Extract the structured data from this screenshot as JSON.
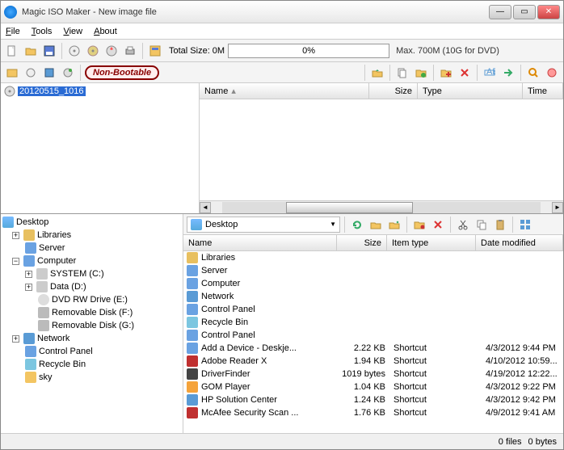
{
  "window": {
    "title": "Magic ISO Maker - New image file"
  },
  "menu": {
    "file": "File",
    "tools": "Tools",
    "view": "View",
    "about": "About"
  },
  "toolbar1": {
    "totalSize": "Total Size: 0M",
    "progress": "0%",
    "max": "Max. 700M (10G for DVD)"
  },
  "bootable": {
    "label": "Non-Bootable"
  },
  "imgtree": {
    "selected": "20120515_1016"
  },
  "imglist": {
    "cols": {
      "name": "Name",
      "size": "Size",
      "type": "Type",
      "time": "Time"
    }
  },
  "tree": {
    "desktop": "Desktop",
    "libraries": "Libraries",
    "server": "Server",
    "computer": "Computer",
    "systemC": "SYSTEM (C:)",
    "dataD": "Data (D:)",
    "dvdE": "DVD RW Drive (E:)",
    "remF": "Removable Disk (F:)",
    "remG": "Removable Disk (G:)",
    "network": "Network",
    "cpanel": "Control Panel",
    "recycle": "Recycle Bin",
    "sky": "sky"
  },
  "path": {
    "current": "Desktop"
  },
  "filelist": {
    "cols": {
      "name": "Name",
      "size": "Size",
      "type": "Item type",
      "date": "Date modified"
    },
    "rows": [
      {
        "name": "Libraries",
        "size": "",
        "type": "",
        "date": "",
        "iconColor": "#e8c060"
      },
      {
        "name": "Server",
        "size": "",
        "type": "",
        "date": "",
        "iconColor": "#6aa2e2"
      },
      {
        "name": "Computer",
        "size": "",
        "type": "",
        "date": "",
        "iconColor": "#6aa2e2"
      },
      {
        "name": "Network",
        "size": "",
        "type": "",
        "date": "",
        "iconColor": "#5a9bd5"
      },
      {
        "name": "Control Panel",
        "size": "",
        "type": "",
        "date": "",
        "iconColor": "#6aa2e2"
      },
      {
        "name": "Recycle Bin",
        "size": "",
        "type": "",
        "date": "",
        "iconColor": "#7cc6e0"
      },
      {
        "name": "Control Panel",
        "size": "",
        "type": "",
        "date": "",
        "iconColor": "#6aa2e2"
      },
      {
        "name": "Add a Device - Deskje...",
        "size": "2.22 KB",
        "type": "Shortcut",
        "date": "4/3/2012 9:44 PM",
        "iconColor": "#6aa2e2"
      },
      {
        "name": "Adobe Reader X",
        "size": "1.94 KB",
        "type": "Shortcut",
        "date": "4/10/2012 10:59...",
        "iconColor": "#c03030"
      },
      {
        "name": "DriverFinder",
        "size": "1019 bytes",
        "type": "Shortcut",
        "date": "4/19/2012 12:22...",
        "iconColor": "#444"
      },
      {
        "name": "GOM Player",
        "size": "1.04 KB",
        "type": "Shortcut",
        "date": "4/3/2012 9:22 PM",
        "iconColor": "#f5a33a"
      },
      {
        "name": "HP Solution Center",
        "size": "1.24 KB",
        "type": "Shortcut",
        "date": "4/3/2012 9:42 PM",
        "iconColor": "#5a9bd5"
      },
      {
        "name": "McAfee Security Scan ...",
        "size": "1.76 KB",
        "type": "Shortcut",
        "date": "4/9/2012 9:41 AM",
        "iconColor": "#c03030"
      }
    ]
  },
  "status": {
    "files": "0 files",
    "bytes": "0 bytes"
  }
}
